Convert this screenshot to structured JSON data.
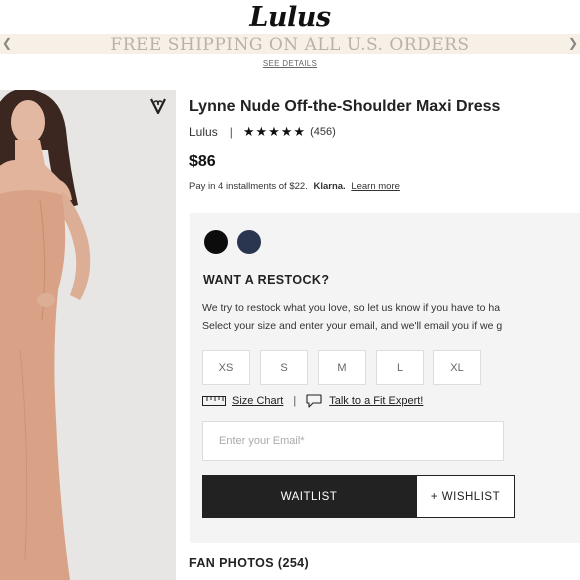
{
  "header": {
    "logo": "Lulus"
  },
  "promo": {
    "text": "FREE SHIPPING ON ALL U.S. ORDERS",
    "details_link": "SEE DETAILS"
  },
  "product": {
    "title": "Lynne Nude Off-the-Shoulder Maxi Dress",
    "brand": "Lulus",
    "separator": "|",
    "stars": "★★★★★",
    "rating": 5,
    "review_count": "(456)",
    "price": "$86",
    "installments_text": "Pay in 4 installments of $22.",
    "klarna_label": "Klarna.",
    "learn_more": "Learn more"
  },
  "colors": {
    "swatches": [
      {
        "name": "black",
        "hex": "#0c0c0c"
      },
      {
        "name": "navy",
        "hex": "#2a3550"
      }
    ],
    "panel_background": "#f4f4f4",
    "skin_tone": "#d9a286"
  },
  "restock": {
    "heading": "WANT A RESTOCK?",
    "line1": "We try to restock what you love, so let us know if you have to ha",
    "line2": "Select your size and enter your email, and we'll email you if we g"
  },
  "sizes": [
    "XS",
    "S",
    "M",
    "L",
    "XL"
  ],
  "fit": {
    "size_chart": "Size Chart",
    "divider": "|",
    "fit_expert": "Talk to a Fit Expert!"
  },
  "email": {
    "placeholder": "Enter your Email*"
  },
  "actions": {
    "waitlist": "WAITLIST",
    "wishlist": "+ WISHLIST"
  },
  "fan_photos": "FAN PHOTOS (254)",
  "icons": {
    "wishlist": "heart-icon",
    "ruler": "ruler-icon",
    "chat": "chat-icon"
  }
}
